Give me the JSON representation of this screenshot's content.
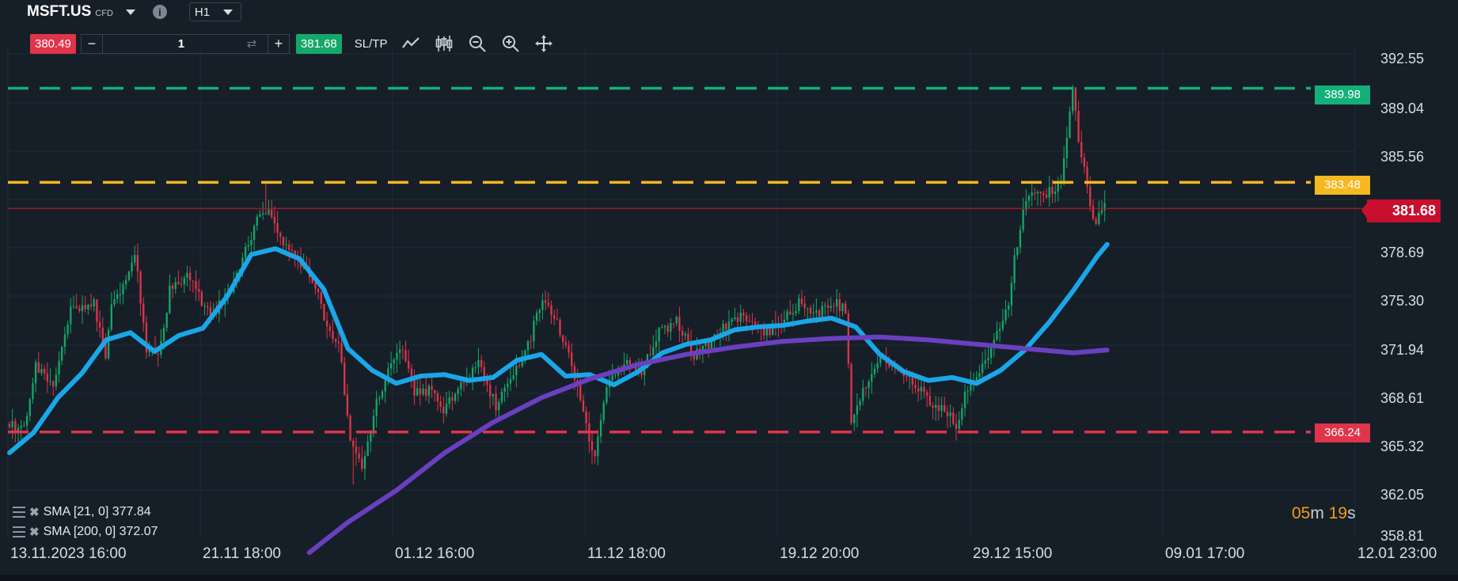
{
  "header": {
    "symbol": "MSFT.US",
    "symbol_suffix": "CFD",
    "timeframe": "H1"
  },
  "trade_bar": {
    "sell_price": "380.49",
    "minus_label": "−",
    "quantity": "1",
    "plus_label": "+",
    "buy_price": "381.68",
    "sltp_label": "SL/TP"
  },
  "levels": {
    "green": "389.98",
    "yellow": "383.48",
    "red": "366.24",
    "current": "381.68"
  },
  "legend": {
    "sma21": "SMA [21, 0] 377.84",
    "sma200": "SMA [200, 0] 372.07"
  },
  "timer": {
    "minutes": "05",
    "m_unit": "m",
    "seconds": "19",
    "s_unit": "s"
  },
  "colors": {
    "background": "#161f28",
    "bull": "#14a869",
    "bear": "#e0344a",
    "sma21": "#1aa6e8",
    "sma200": "#6a3fc0",
    "green_level": "#13b07a",
    "yellow_level": "#f5b820",
    "red_level": "#e0344a",
    "current_line": "#c8102e"
  },
  "chart_data": {
    "type": "candlestick",
    "symbol": "MSFT.US",
    "timeframe": "H1",
    "y_ticks": [
      "392.55",
      "389.04",
      "385.56",
      "378.69",
      "375.30",
      "371.94",
      "368.61",
      "365.32",
      "362.05",
      "358.81"
    ],
    "x_ticks": [
      "13.11.2023 16:00",
      "21.11 18:00",
      "01.12 16:00",
      "11.12 18:00",
      "19.12 20:00",
      "29.12 15:00",
      "09.01 17:00",
      "12.01 23:00"
    ],
    "ylim": [
      357.5,
      395.5
    ],
    "grid": true,
    "horizontal_levels": [
      {
        "value": 389.98,
        "style": "dashed",
        "color": "green"
      },
      {
        "value": 383.48,
        "style": "dashed",
        "color": "yellow"
      },
      {
        "value": 366.24,
        "style": "dashed",
        "color": "red"
      },
      {
        "value": 381.68,
        "style": "solid",
        "color": "red",
        "label": "current price"
      }
    ],
    "series": [
      {
        "name": "SMA [21, 0]",
        "type": "line",
        "x": [
          0,
          10,
          20,
          30,
          40,
          50,
          60,
          70,
          80,
          90,
          100,
          110,
          120,
          130,
          140,
          150,
          160,
          170,
          180,
          190,
          200,
          210,
          220,
          230,
          240,
          250,
          260,
          270,
          280,
          290,
          300,
          310,
          320,
          330,
          340,
          350,
          360,
          370,
          380,
          390,
          400,
          410,
          420,
          430,
          440,
          450,
          454
        ],
        "values": [
          364.8,
          366.2,
          368.6,
          370.3,
          372.6,
          373.1,
          371.8,
          372.9,
          373.4,
          375.6,
          378.5,
          378.9,
          378.2,
          376.1,
          372.0,
          370.5,
          369.6,
          370.1,
          370.2,
          369.8,
          370.0,
          371.2,
          371.6,
          370.1,
          370.2,
          369.5,
          370.4,
          371.7,
          372.3,
          372.6,
          373.3,
          373.5,
          373.6,
          373.9,
          374.1,
          373.5,
          371.6,
          370.4,
          369.8,
          370.0,
          369.6,
          370.5,
          371.9,
          373.8,
          376.0,
          378.4,
          379.2
        ]
      },
      {
        "name": "SMA [200, 0]",
        "type": "line",
        "x": [
          124,
          140,
          160,
          180,
          200,
          220,
          240,
          260,
          280,
          300,
          320,
          340,
          360,
          380,
          400,
          420,
          440,
          454
        ],
        "values": [
          357.9,
          360.0,
          362.2,
          364.8,
          366.9,
          368.6,
          369.9,
          370.9,
          371.6,
          372.1,
          372.5,
          372.7,
          372.8,
          372.6,
          372.3,
          372.0,
          371.7,
          371.9
        ]
      }
    ]
  }
}
